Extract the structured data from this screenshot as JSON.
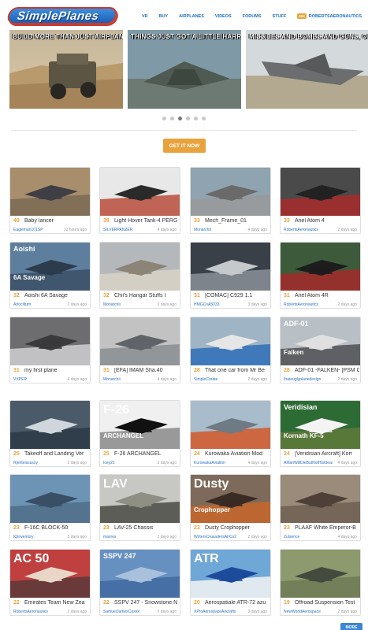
{
  "header": {
    "logo_text": "SimplePlanes",
    "nav": [
      "VR",
      "BUY",
      "AIRPLANES",
      "VIDEOS",
      "FORUMS",
      "STUFF"
    ],
    "user_badge": "454",
    "username": "ROBERTSAERONAUTICS"
  },
  "carousel": {
    "slides": [
      {
        "caption": "BUILD MORE THAN JUST AIRPLANES"
      },
      {
        "caption": "THINGS JUST GOT A LITTLE HARRIER"
      },
      {
        "caption": "MISSILES AND BOMBS AND GUNS, OH MY."
      }
    ],
    "dot_count": 6,
    "active_dot": 3
  },
  "cta_label": "GET IT NOW",
  "more_label": "MORE",
  "colors": {
    "accent": "#e8a33d",
    "link": "#2a73c0",
    "brand": "#1d6fb8"
  },
  "cards": [
    {
      "score": "40",
      "title": "Baby lancer",
      "author": "Eagleman101SP",
      "time": "12 hours ago"
    },
    {
      "score": "39",
      "title": "Light Hover Tank-4 PERG",
      "author": "SILVERPANZER",
      "time": "4 days ago"
    },
    {
      "score": "33",
      "title": "Mech_Frame_01",
      "author": "Monarchii",
      "time": "4 days ago"
    },
    {
      "score": "33",
      "title": "Ariel Atom 4",
      "author": "RobertsAeronautics",
      "time": "2 days ago"
    },
    {
      "score": "32",
      "title": "Aoishi 6A Savage",
      "author": "Atrociltum",
      "time": "2 days ago",
      "overlay_top": "Aoishi",
      "overlay_bottom": "6A Savage"
    },
    {
      "score": "32",
      "title": "Chii's Hangar Stuffs I",
      "author": "Monarchii",
      "time": "3 days ago"
    },
    {
      "score": "31",
      "title": "[COMAC] C929 1.1",
      "author": "HMGCoA5033",
      "time": "3 days ago"
    },
    {
      "score": "31",
      "title": "Ariel Atom 4R",
      "author": "RobertsAeronautics",
      "time": "2 days ago"
    },
    {
      "score": "31",
      "title": "my first plane",
      "author": "VXPER",
      "time": "4 days ago"
    },
    {
      "score": "31",
      "title": "[EFA] IMAM Sha.40",
      "author": "Monarchii",
      "time": "4 days ago"
    },
    {
      "score": "28",
      "title": "That one car from Mr Be",
      "author": "SimpleCreate",
      "time": "2 days ago"
    },
    {
      "score": "28",
      "title": "ADF-01 -FALKEN- [PSM C",
      "author": "Ihateuglyplanedesign",
      "time": "2 days ago",
      "overlay_top": "ADF-01",
      "overlay_bottom": "Falken"
    },
    {
      "score": "25",
      "title": "Takeoff and Landing Ver",
      "author": "Rjenteissussy",
      "time": "2 days ago"
    },
    {
      "score": "25",
      "title": "F-26 ARCHANGEL",
      "author": "Icey21",
      "time": "3 days ago",
      "overlay_top": "F-26",
      "overlay_bottom": "ARCHANGEL"
    },
    {
      "score": "24",
      "title": "Kurowaka Aviation Mod",
      "author": "KurowakaAviation",
      "time": "4 days ago"
    },
    {
      "score": "24",
      "title": "[Veridisian Aircraft] Korr",
      "author": "AManWillDieButNotHisIdeas",
      "time": "4 days ago",
      "overlay_top": "Veridisian",
      "overlay_bottom": "Kornath KF-5"
    },
    {
      "score": "23",
      "title": "F-16C BLOCK-50",
      "author": "IQinventory",
      "time": "3 days ago"
    },
    {
      "score": "23",
      "title": "LAV-25 Chassis",
      "author": "maxres",
      "time": "2 days ago",
      "overlay_top": "LAV"
    },
    {
      "score": "23",
      "title": "Dusty Crophopper",
      "author": "WritersCrusadersAirCo2",
      "time": "2 days ago",
      "overlay_top": "Dusty",
      "overlay_bottom": "Crophopper"
    },
    {
      "score": "23",
      "title": "PLAAF White Emperor-B",
      "author": "Zulsence",
      "time": "4 days ago"
    },
    {
      "score": "22",
      "title": "Emirates Team New Zea",
      "author": "RobertsAeronautics",
      "time": "2 days ago",
      "overlay_top": "AC 50"
    },
    {
      "score": "22",
      "title": "SSPV 247 - Snowstone N",
      "author": "SamuelJamesCastor",
      "time": "2 days ago",
      "overlay_top": "SSPV 247"
    },
    {
      "score": "20",
      "title": "Aerospatiale ATR-72 azu",
      "author": "XProAerospaceAircrafts",
      "time": "3 days ago",
      "overlay_top": "ATR"
    },
    {
      "score": "19",
      "title": "Offroad Suspension Test",
      "author": "NewWorldAerospace",
      "time": "2 days ago"
    }
  ]
}
